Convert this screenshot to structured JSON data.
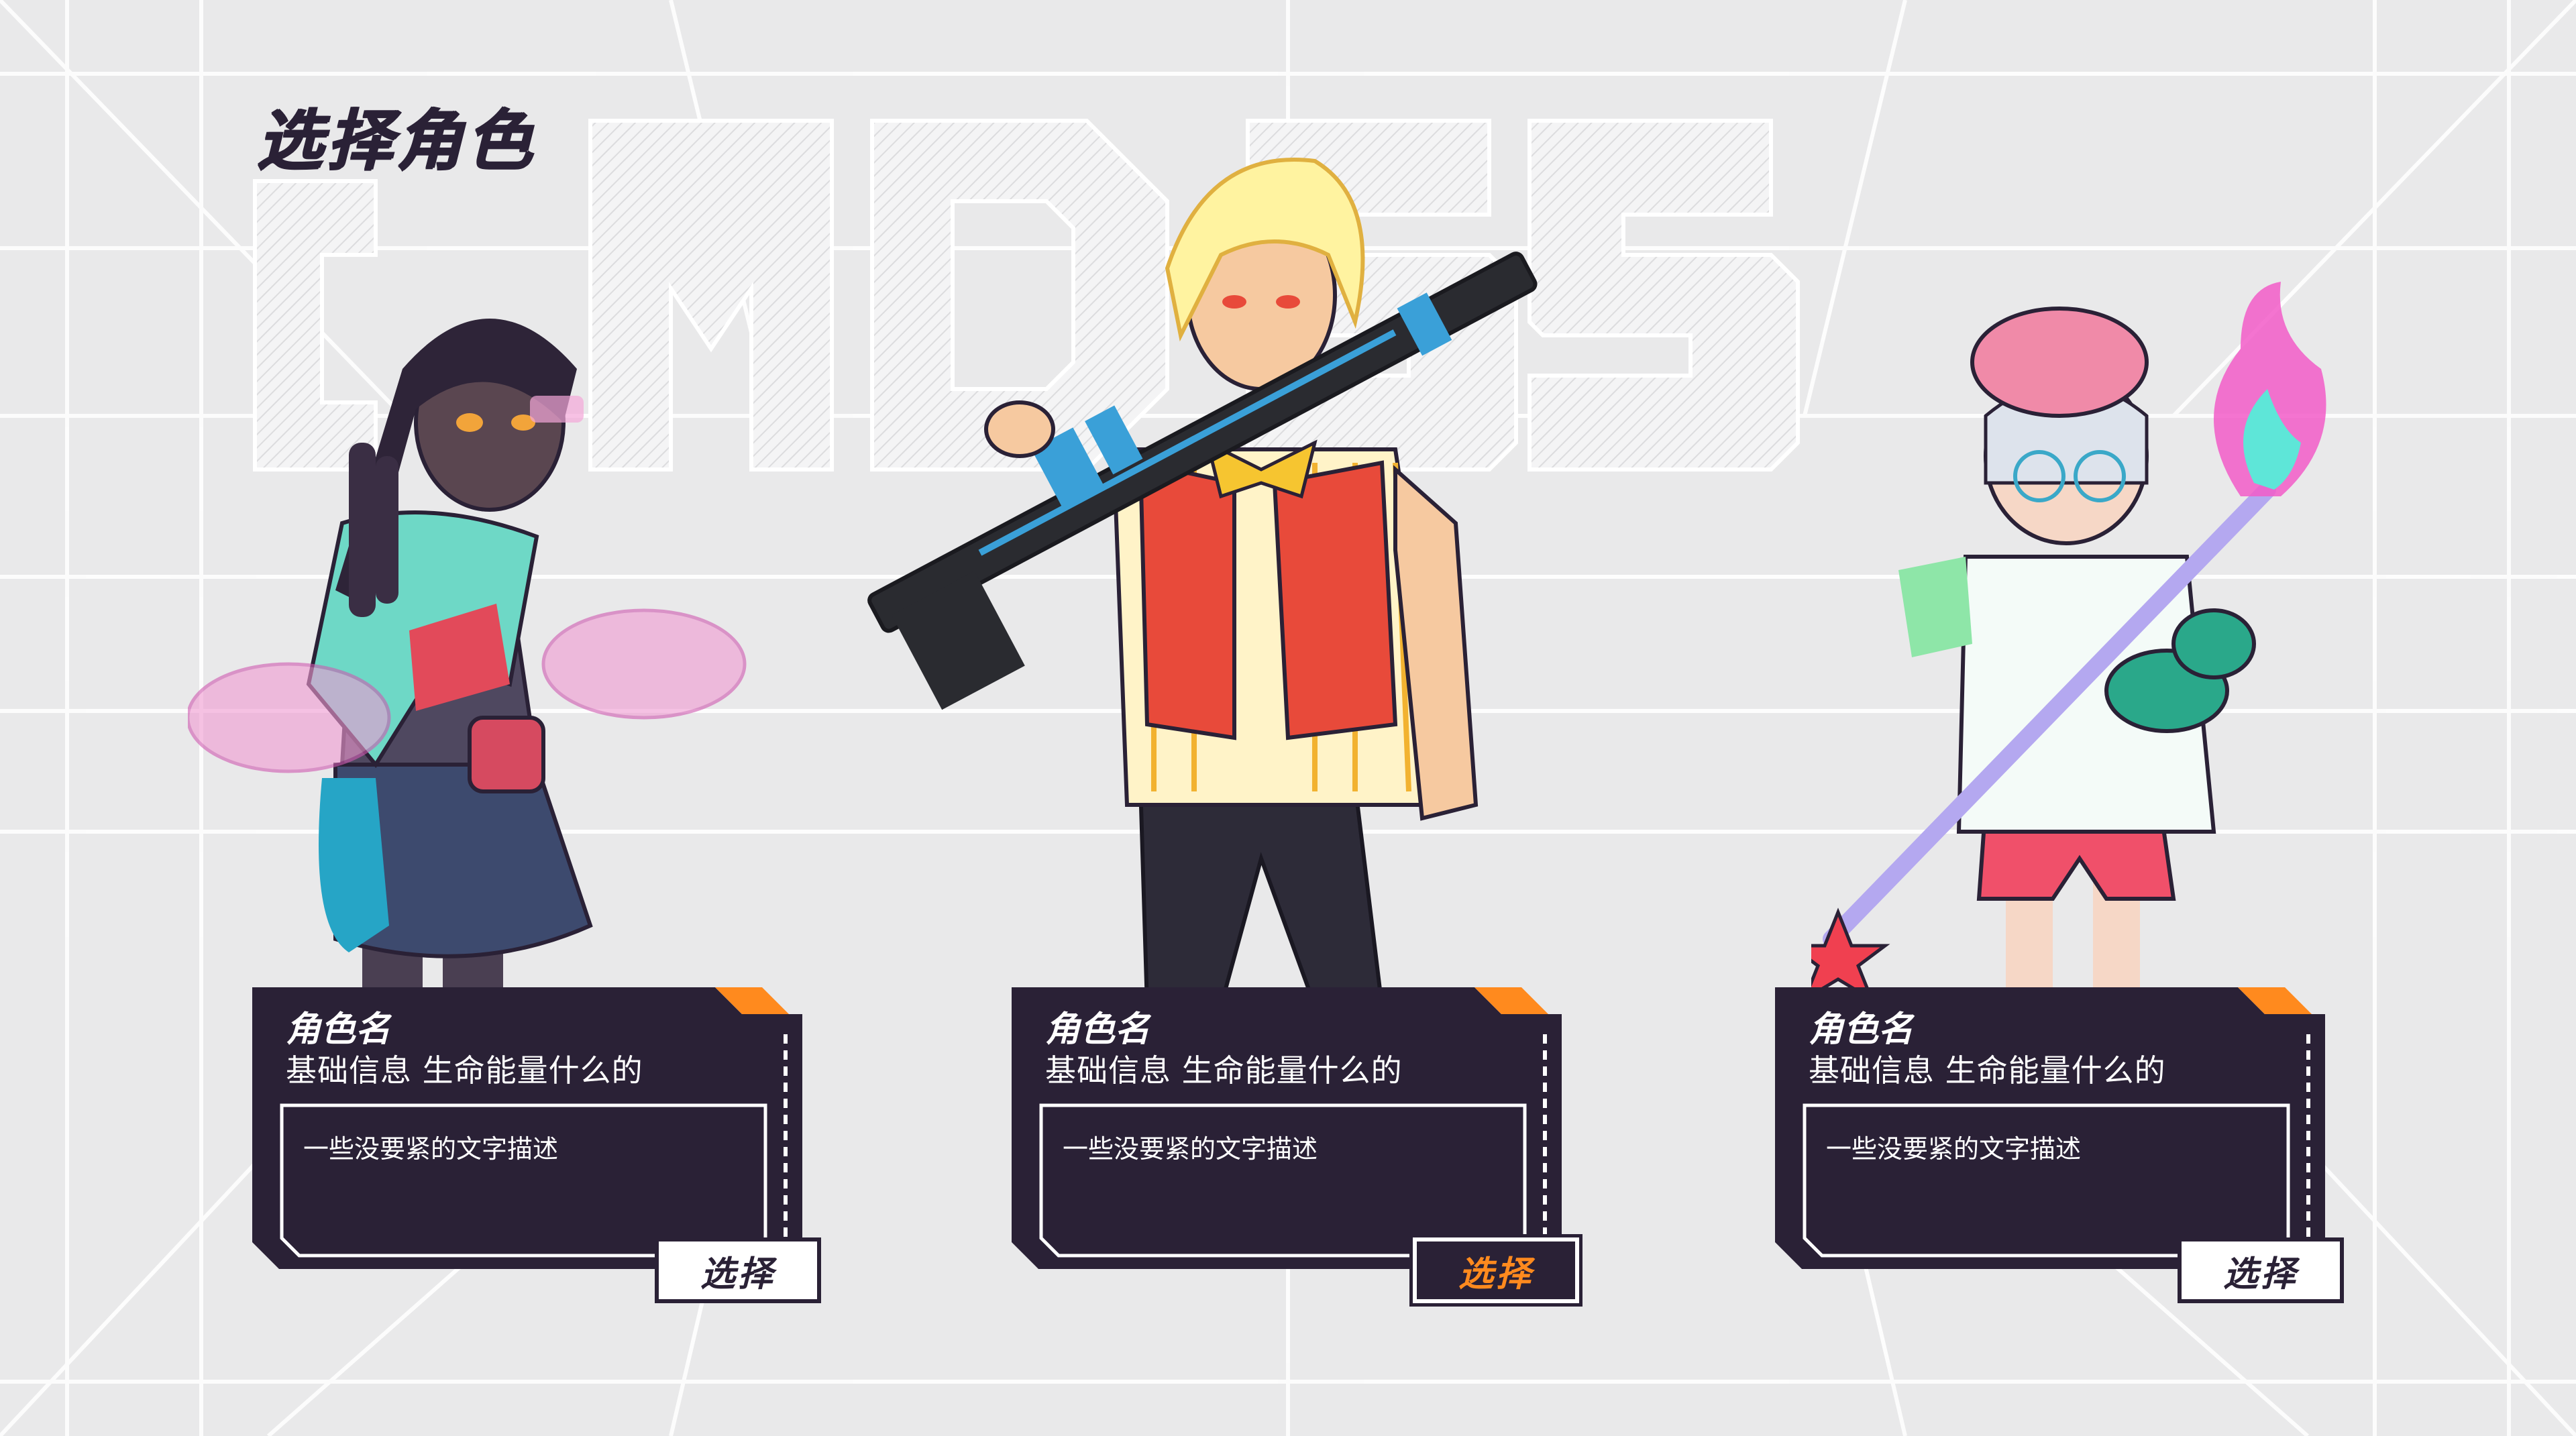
{
  "page": {
    "title": "选择角色",
    "watermark": "CMDS"
  },
  "colors": {
    "panel": "#2a2136",
    "accent": "#ff8a1e",
    "background": "#e9e9ea",
    "text_light": "#ffffff"
  },
  "characters": [
    {
      "name": "角色名",
      "info": "基础信息  生命能量什么的",
      "description": "一些没要紧的文字描述",
      "select_label": "选择",
      "selected": false
    },
    {
      "name": "角色名",
      "info": "基础信息  生命能量什么的",
      "description": "一些没要紧的文字描述",
      "select_label": "选择",
      "selected": true
    },
    {
      "name": "角色名",
      "info": "基础信息  生命能量什么的",
      "description": "一些没要紧的文字描述",
      "select_label": "选择",
      "selected": false
    }
  ]
}
